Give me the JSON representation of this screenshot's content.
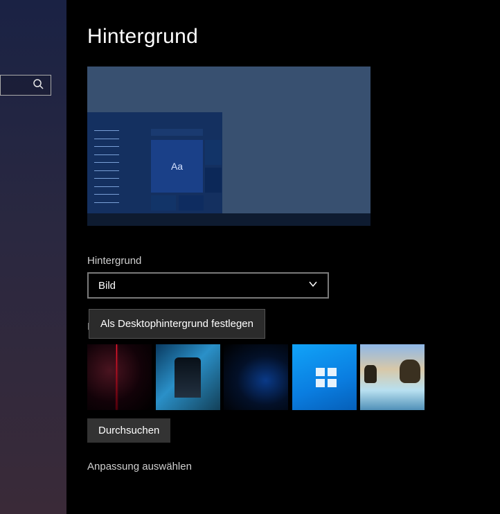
{
  "page": {
    "title": "Hintergrund"
  },
  "preview": {
    "sample_text": "Aa"
  },
  "background_section": {
    "label": "Hintergrund",
    "dropdown_value": "Bild"
  },
  "context_menu": {
    "set_as_wallpaper": "Als Desktophintergrund festlegen"
  },
  "thumbnails": {
    "hidden_label_initial": "I",
    "items": [
      {
        "name": "recent-image-1"
      },
      {
        "name": "recent-image-2"
      },
      {
        "name": "recent-image-3"
      },
      {
        "name": "recent-image-4"
      },
      {
        "name": "recent-image-5"
      }
    ]
  },
  "browse_button": "Durchsuchen",
  "fit_section": {
    "label": "Anpassung auswählen"
  }
}
